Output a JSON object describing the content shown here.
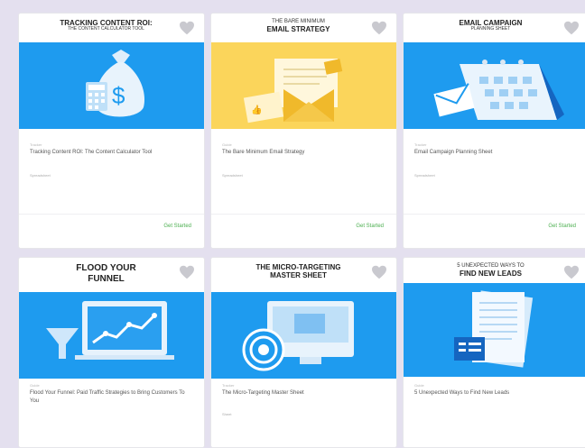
{
  "colors": {
    "blue": "#1e9bef",
    "yellow": "#fbd55b",
    "green": "#4caf50",
    "bg": "#e4e0ef"
  },
  "cards": [
    {
      "title": "TRACKING CONTENT ROI:",
      "subtitle": "THE CONTENT CALCULATOR TOOL",
      "category": "Tracker",
      "description": "Tracking Content ROI: The Content Calculator Tool",
      "meta": "Spreadsheet",
      "cta": "Get Started",
      "icon": "money-bag-calculator-icon",
      "banner": "blue"
    },
    {
      "title": "THE BARE MINIMUM",
      "subtitle": "EMAIL STRATEGY",
      "category": "Guide",
      "description": "The Bare Minimum Email Strategy",
      "meta": "Spreadsheet",
      "cta": "Get Started",
      "icon": "envelope-letter-icon",
      "banner": "yellow"
    },
    {
      "title": "EMAIL CAMPAIGN",
      "subtitle": "PLANNING SHEET",
      "category": "Tracker",
      "description": "Email Campaign Planning Sheet",
      "meta": "Spreadsheet",
      "cta": "Get Started",
      "icon": "calendar-envelope-icon",
      "banner": "blue"
    },
    {
      "title": "FLOOD YOUR",
      "subtitle": "FUNNEL",
      "category": "Guide",
      "description": "Flood Your Funnel: Paid Traffic Strategies to Bring Customers To You",
      "meta": "",
      "cta": "",
      "icon": "funnel-laptop-icon",
      "banner": "blue"
    },
    {
      "title": "THE MICRO-TARGETING",
      "subtitle": "MASTER SHEET",
      "category": "Tracker",
      "description": "The Micro-Targeting Master Sheet",
      "meta": "Sheet",
      "cta": "",
      "icon": "target-monitor-icon",
      "banner": "blue"
    },
    {
      "title": "5 UNEXPECTED WAYS TO",
      "subtitle": "FIND NEW LEADS",
      "category": "Guide",
      "description": "5 Unexpected Ways to Find New Leads",
      "meta": "",
      "cta": "",
      "icon": "document-list-icon",
      "banner": "blue"
    }
  ]
}
